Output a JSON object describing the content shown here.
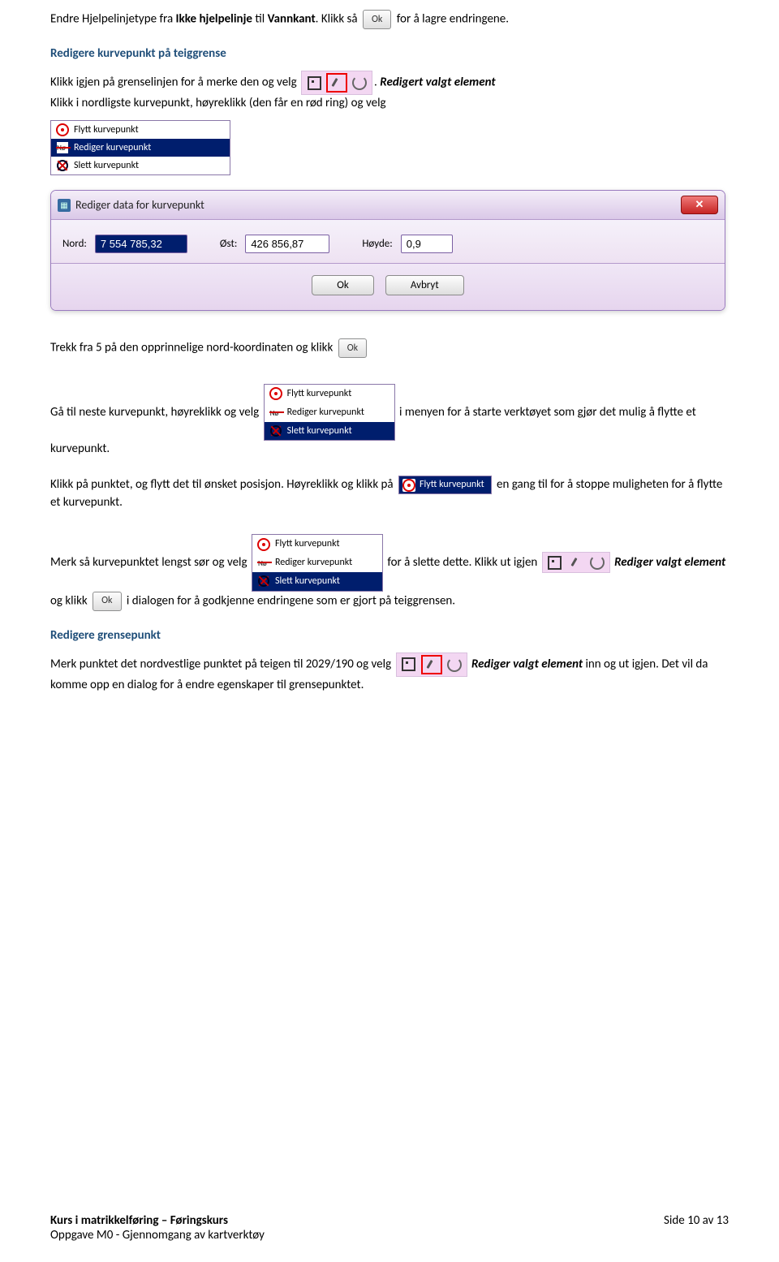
{
  "p1": {
    "a": "Endre Hjelpelinjetype fra ",
    "b": "Ikke hjelpelinje",
    "c": " til ",
    "d": "Vannkant",
    "e": ". Klikk så ",
    "f": " for å lagre endringene."
  },
  "h1": "Redigere kurvepunkt på teiggrense",
  "p2": {
    "a": "Klikk igjen på grenselinjen for å merke den og velg ",
    "b": ". ",
    "c": "Redigert valgt element",
    "d": "Klikk i nordligste kurvepunkt, høyreklikk (den får en rød ring) og velg"
  },
  "menu": {
    "flytt": "Flytt kurvepunkt",
    "rediger": "Rediger kurvepunkt",
    "slett": "Slett kurvepunkt"
  },
  "dialog": {
    "title": "Rediger data for kurvepunkt",
    "nord_lbl": "Nord:",
    "nord_val": "7 554 785,32",
    "ost_lbl": "Øst:",
    "ost_val": "426 856,87",
    "hoyde_lbl": "Høyde:",
    "hoyde_val": "0,9",
    "ok": "Ok",
    "avbryt": "Avbryt"
  },
  "p3": "Trekk fra 5 på den opprinnelige nord-koordinaten og klikk ",
  "p4": {
    "a": "Gå til neste kurvepunkt, høyreklikk og velg ",
    "b": " i menyen for å starte verktøyet som gjør det mulig å flytte et kurvepunkt."
  },
  "p5": {
    "a": "Klikk på punktet, og flytt det til ønsket posisjon. Høyreklikk og klikk på ",
    "b": " en gang til for å stoppe muligheten for å flytte et kurvepunkt."
  },
  "p6": {
    "a": "Merk så kurvepunktet lengst sør og velg ",
    "b": " for å slette dette. Klikk ut igjen ",
    "c": "Rediger valgt element",
    "d": " og klikk ",
    "e": " i dialogen for å godkjenne endringene som er gjort på teiggrensen."
  },
  "h2": "Redigere grensepunkt",
  "p7": {
    "a": "Merk punktet det nordvestlige punktet på teigen til 2029/190 og velg ",
    "b": "Rediger valgt element",
    "c": " inn og ut igjen. Det vil da komme opp en dialog for å endre egenskaper til grensepunktet."
  },
  "ok_label": "Ok",
  "footer": {
    "l1": "Kurs i matrikkelføring – Føringskurs",
    "l2": "Oppgave M0 - Gjennomgang av kartverktøy",
    "r": "Side 10 av 13"
  }
}
